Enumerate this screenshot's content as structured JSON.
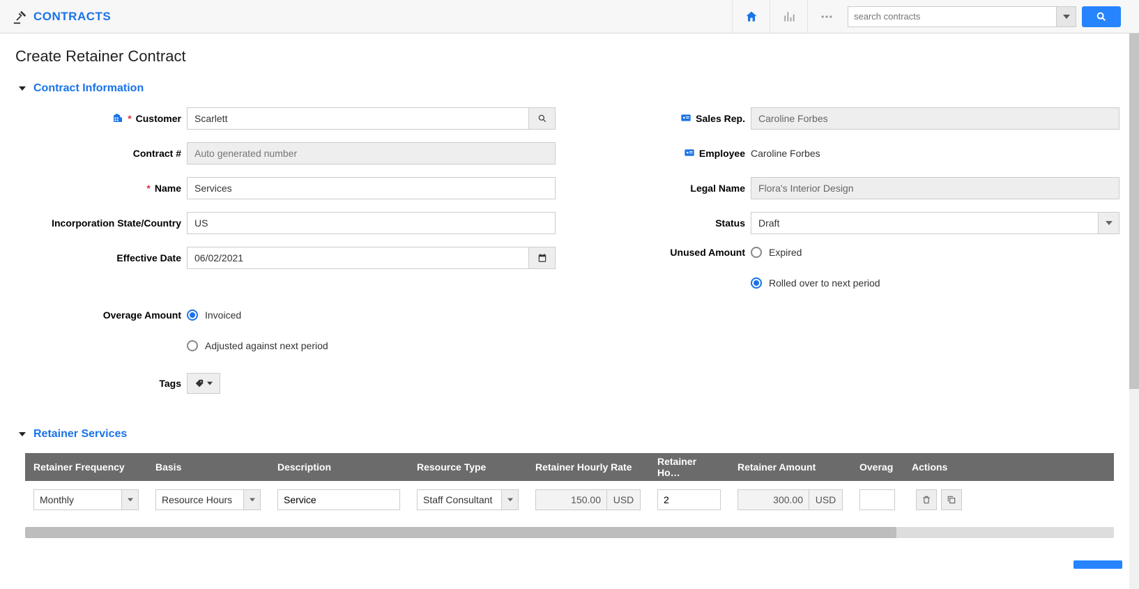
{
  "app": {
    "name": "CONTRACTS",
    "search_placeholder": "search contracts"
  },
  "page": {
    "title": "Create Retainer Contract"
  },
  "sections": {
    "contract_info": "Contract Information",
    "retainer_services": "Retainer Services"
  },
  "labels": {
    "customer": "Customer",
    "contract_no": "Contract #",
    "name": "Name",
    "inc_state": "Incorporation State/Country",
    "effective_date": "Effective Date",
    "overage_amount": "Overage Amount",
    "tags": "Tags",
    "sales_rep": "Sales Rep.",
    "employee": "Employee",
    "legal_name": "Legal Name",
    "status": "Status",
    "unused_amount": "Unused Amount"
  },
  "values": {
    "customer": "Scarlett",
    "contract_no_placeholder": "Auto generated number",
    "name": "Services",
    "inc_state": "US",
    "effective_date": "06/02/2021",
    "sales_rep": "Caroline Forbes",
    "employee": "Caroline Forbes",
    "legal_name": "Flora's Interior Design",
    "status": "Draft"
  },
  "radios": {
    "overage_invoiced": "Invoiced",
    "overage_adjusted": "Adjusted against next period",
    "unused_expired": "Expired",
    "unused_rolled": "Rolled over to next period"
  },
  "table": {
    "headers": {
      "freq": "Retainer Frequency",
      "basis": "Basis",
      "desc": "Description",
      "rtype": "Resource Type",
      "rate": "Retainer Hourly Rate",
      "hours": "Retainer Ho…",
      "amount": "Retainer Amount",
      "overage": "Overag",
      "actions": "Actions"
    },
    "row": {
      "freq": "Monthly",
      "basis": "Resource Hours",
      "desc": "Service",
      "rtype": "Staff Consultant",
      "rate": "150.00",
      "hours": "2",
      "amount": "300.00",
      "currency": "USD",
      "overage": ""
    }
  }
}
